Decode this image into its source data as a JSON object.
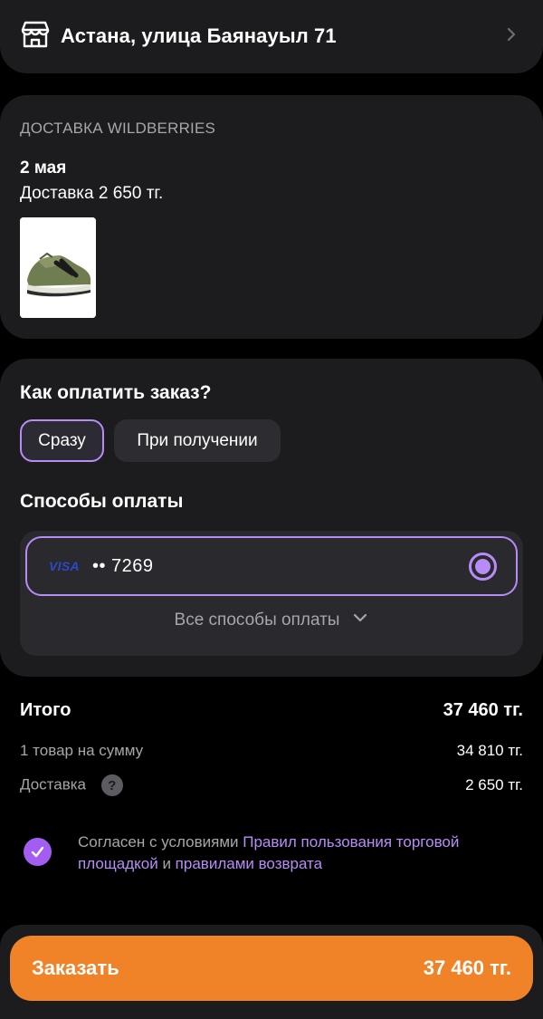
{
  "address": {
    "text": "Астана, улица Баянауыл 71"
  },
  "delivery": {
    "label": "ДОСТАВКА WILDBERRIES",
    "date": "2 мая",
    "cost": "Доставка 2 650 тг."
  },
  "payment": {
    "question": "Как оплатить заказ?",
    "options": [
      "Сразу",
      "При получении"
    ],
    "methods_title": "Способы оплаты",
    "card_brand": "VISA",
    "card_number": "•• 7269",
    "all_methods": "Все способы оплаты"
  },
  "totals": {
    "total_label": "Итого",
    "total_value": "37 460 тг.",
    "items_label": "1 товар на сумму",
    "items_value": "34 810 тг.",
    "delivery_label": "Доставка",
    "help_symbol": "?",
    "delivery_value": "2 650 тг."
  },
  "agreement": {
    "prefix": "Согласен с условиями ",
    "link1": "Правил пользования торговой площадкой",
    "middle": " и ",
    "link2": "правилами возврата"
  },
  "order": {
    "button_label": "Заказать",
    "button_amount": "37 460 тг."
  },
  "colors": {
    "accent": "#b78cf7",
    "check": "#a35ef1",
    "order": "#f08228",
    "card": "#1c1c1f"
  }
}
